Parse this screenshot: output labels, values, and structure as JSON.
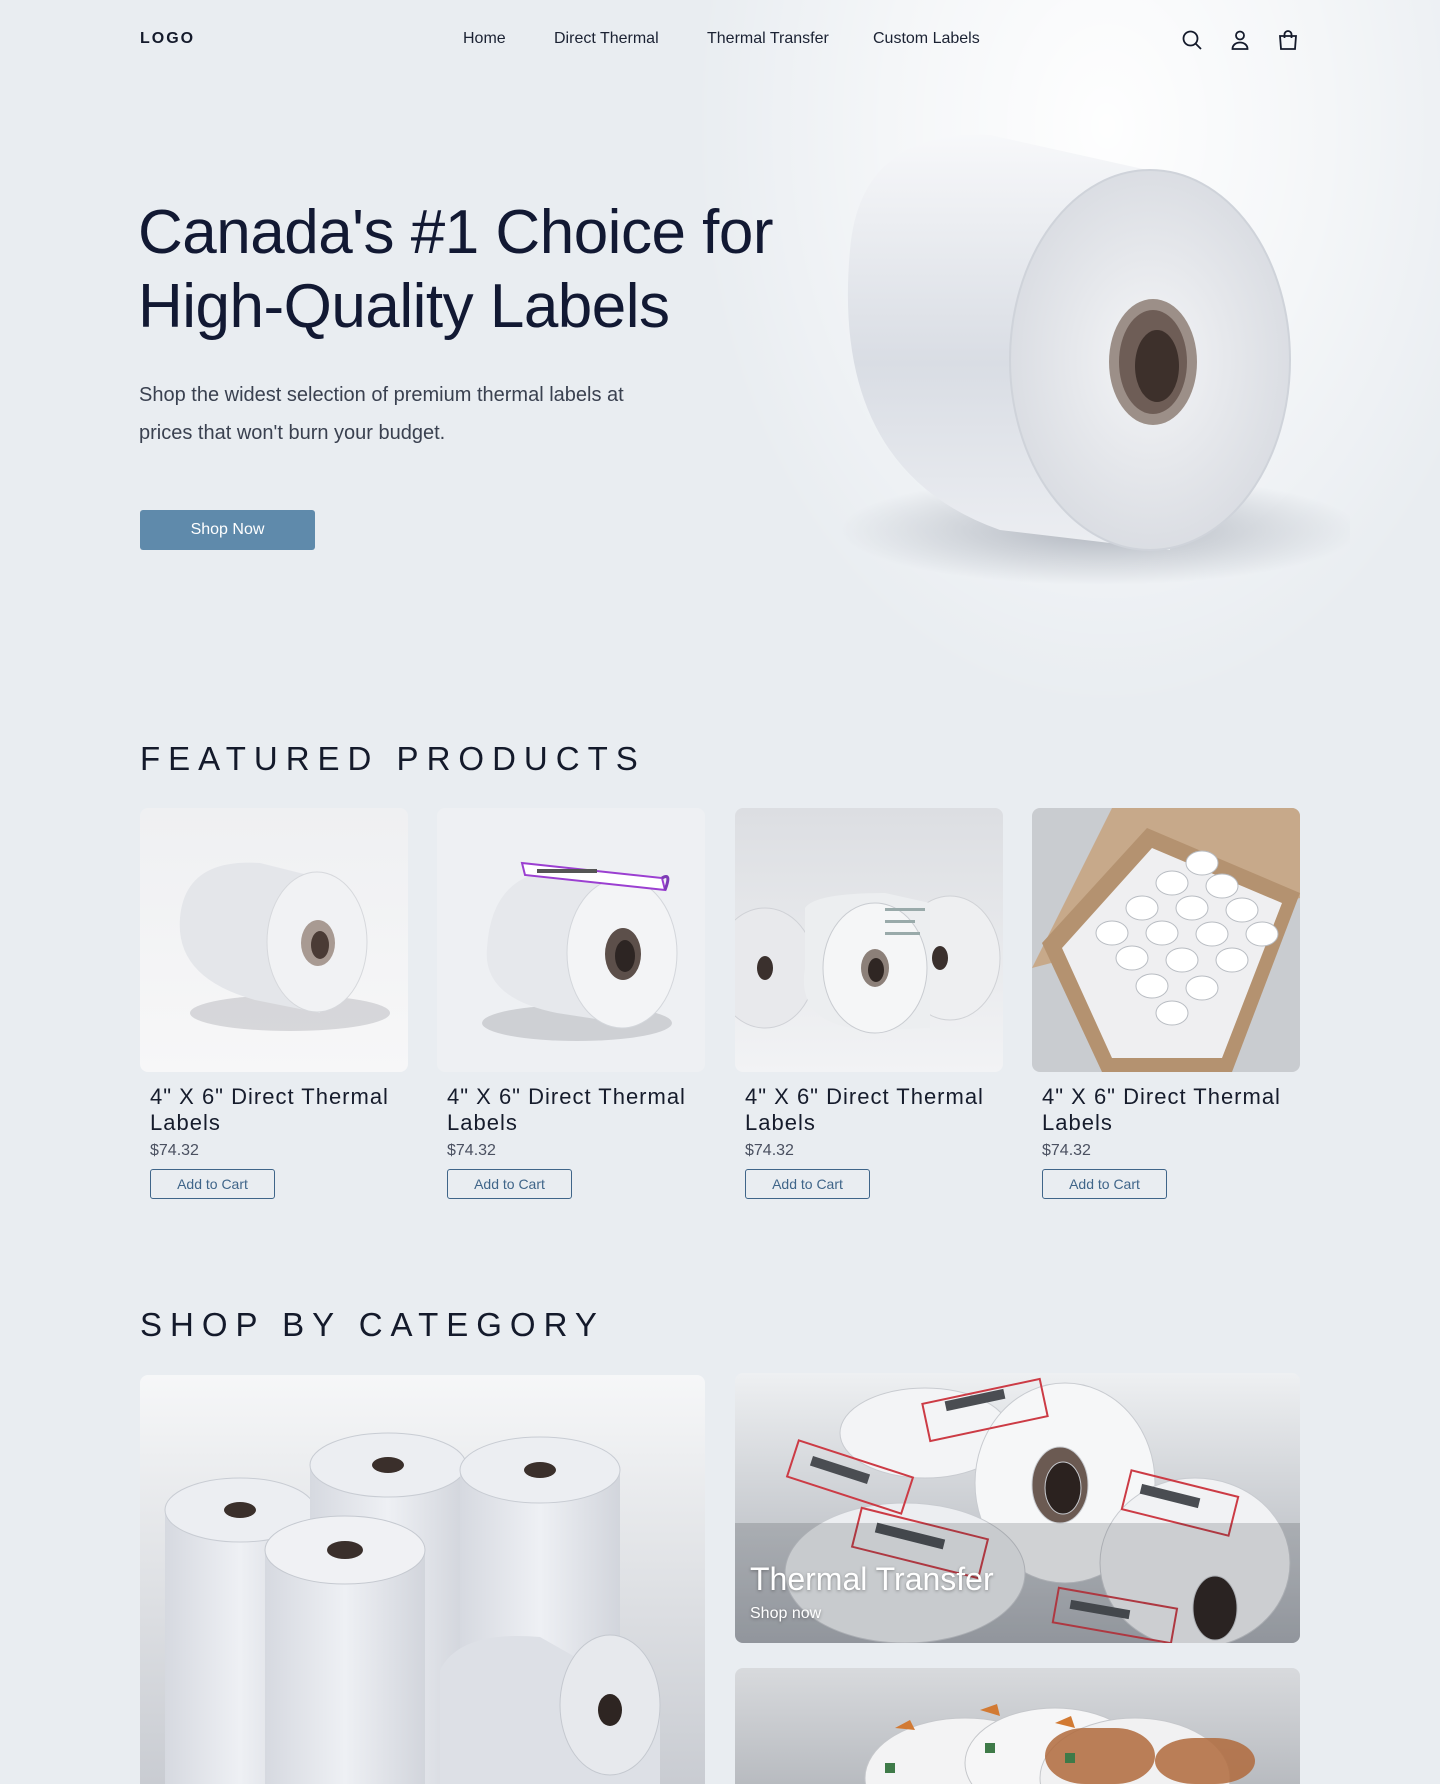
{
  "header": {
    "logo": "LOGO",
    "nav": [
      "Home",
      "Direct Thermal",
      "Thermal Transfer",
      "Custom Labels"
    ],
    "icons": [
      "search-icon",
      "account-icon",
      "cart-icon"
    ]
  },
  "hero": {
    "title": "Canada's #1 Choice for High-Quality Labels",
    "subtitle": "Shop the widest selection of premium thermal labels at prices that won't burn your budget.",
    "cta": "Shop Now"
  },
  "featured": {
    "title": "FEATURED PRODUCTS",
    "products": [
      {
        "name": "4\" X 6\" Direct Thermal Labels",
        "price": "$74.32",
        "cta": "Add to Cart"
      },
      {
        "name": "4\" X 6\" Direct Thermal Labels",
        "price": "$74.32",
        "cta": "Add to Cart"
      },
      {
        "name": "4\" X 6\" Direct Thermal Labels",
        "price": "$74.32",
        "cta": "Add to Cart"
      },
      {
        "name": "4\" X 6\" Direct Thermal Labels",
        "price": "$74.32",
        "cta": "Add to Cart"
      }
    ]
  },
  "categories": {
    "title": "SHOP BY CATEGORY",
    "tiles": [
      {
        "label": "",
        "link": ""
      },
      {
        "label": "Thermal Transfer",
        "link": "Shop now"
      },
      {
        "label": "",
        "link": ""
      }
    ]
  },
  "colors": {
    "background": "#e9edf1",
    "primary_button": "#5f8aab",
    "outline_button": "#3f6589",
    "heading": "#121933"
  }
}
